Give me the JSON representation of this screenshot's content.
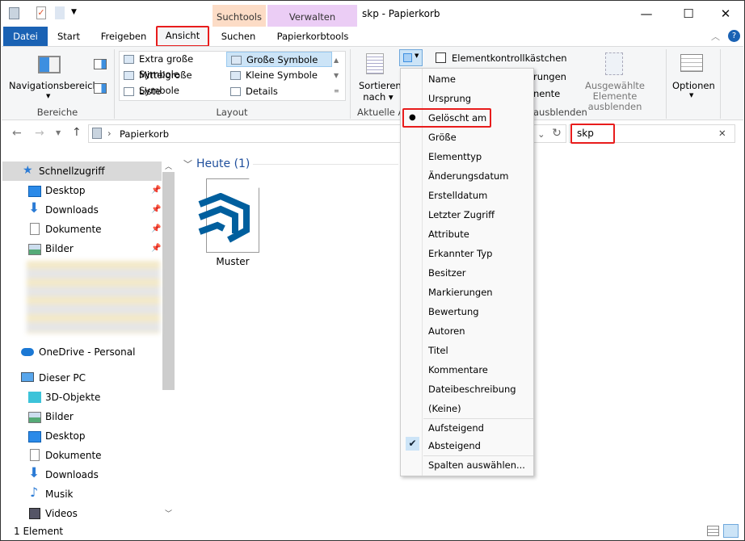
{
  "window": {
    "title": "skp - Papierkorb",
    "context_tabs": [
      "Suchtools",
      "Verwalten"
    ],
    "controls": [
      "minimize",
      "maximize",
      "close"
    ]
  },
  "tabs": {
    "datei": "Datei",
    "start": "Start",
    "freigeben": "Freigeben",
    "ansicht": "Ansicht",
    "suchen": "Suchen",
    "papierkorbtools": "Papierkorbtools"
  },
  "ribbon": {
    "bereiche": {
      "navigationsbereich": "Navigationsbereich",
      "label": "Bereiche"
    },
    "layout": {
      "items": [
        "Extra große Symbole",
        "Große Symbole",
        "Mittelgroße Symbole",
        "Kleine Symbole",
        "Liste",
        "Details"
      ],
      "selected": "Große Symbole",
      "label": "Layout"
    },
    "aktuelle": {
      "sortieren1": "Sortieren",
      "sortieren2": "nach",
      "label": "Aktuelle A"
    },
    "einblenden": {
      "checkbox": "Elementkontrollkästchen",
      "partial1": "rungen",
      "partial2": "nente",
      "hide1": "Ausgewählte",
      "hide2": "Elemente ausblenden",
      "label": "ausblenden"
    },
    "optionen": "Optionen"
  },
  "address": {
    "path": "Papierkorb",
    "search_value": "skp"
  },
  "sidebar": {
    "quick": "Schnellzugriff",
    "quick_items": [
      "Desktop",
      "Downloads",
      "Dokumente",
      "Bilder"
    ],
    "onedrive": "OneDrive - Personal",
    "pc": "Dieser PC",
    "pc_items": [
      "3D-Objekte",
      "Bilder",
      "Desktop",
      "Dokumente",
      "Downloads",
      "Musik",
      "Videos"
    ]
  },
  "content": {
    "group": "Heute (1)",
    "file": "Muster"
  },
  "menu": {
    "items": [
      "Name",
      "Ursprung",
      "Gelöscht am",
      "Größe",
      "Elementtyp",
      "Änderungsdatum",
      "Erstelldatum",
      "Letzter Zugriff",
      "Attribute",
      "Erkannter Typ",
      "Besitzer",
      "Markierungen",
      "Bewertung",
      "Autoren",
      "Titel",
      "Kommentare",
      "Dateibeschreibung",
      "(Keine)"
    ],
    "selected": "Gelöscht am",
    "order": [
      "Aufsteigend",
      "Absteigend"
    ],
    "order_selected": "Absteigend",
    "choose": "Spalten auswählen..."
  },
  "status": {
    "count": "1 Element"
  },
  "colors": {
    "accent": "#1a62b4",
    "highlight": "#e81c1c",
    "sketchup": "#005f9e"
  }
}
